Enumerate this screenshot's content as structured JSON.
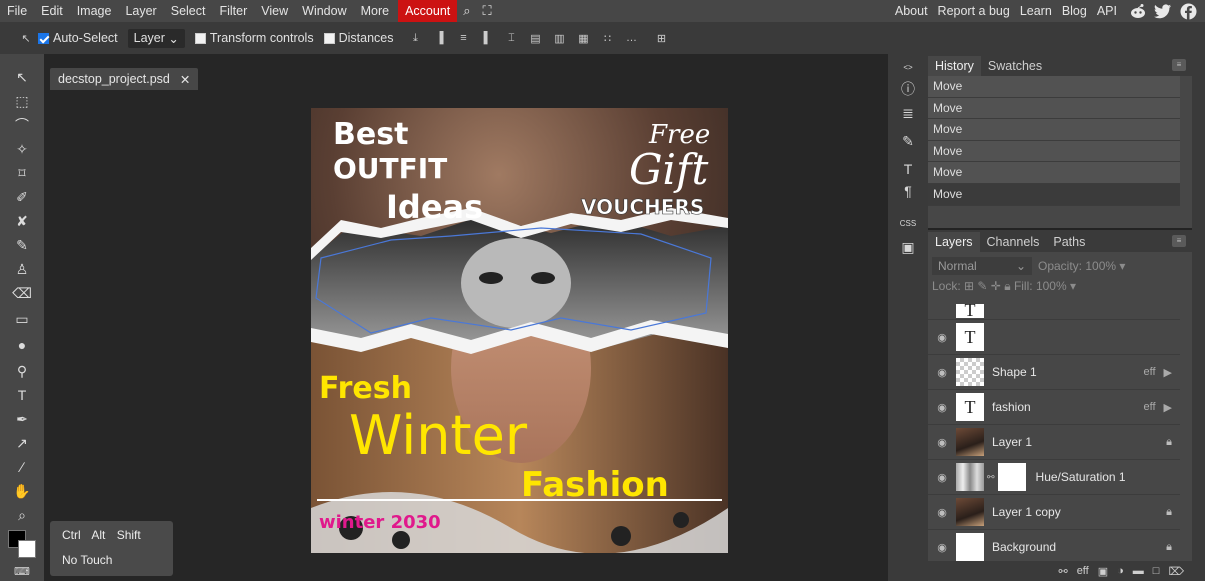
{
  "menu": {
    "items": [
      "File",
      "Edit",
      "Image",
      "Layer",
      "Select",
      "Filter",
      "View",
      "Window",
      "More"
    ],
    "account": "Account",
    "right_items": [
      "About",
      "Report a bug",
      "Learn",
      "Blog",
      "API"
    ]
  },
  "options": {
    "auto_select": "Auto-Select",
    "layer_select": "Layer",
    "transform_controls": "Transform controls",
    "distances": "Distances"
  },
  "document": {
    "tab_name": "decstop_project.psd",
    "poster": {
      "headline": [
        "Best",
        "OUTFIT",
        "Ideas"
      ],
      "free": "Free",
      "gift": "Gift",
      "vouchers": "VOUCHERS",
      "fresh": "Fresh",
      "winter": "Winter",
      "fashion": "Fashion",
      "year_line": "winter 2030"
    }
  },
  "key_help": {
    "modifiers": [
      "Ctrl",
      "Alt",
      "Shift"
    ],
    "mode": "No Touch"
  },
  "history": {
    "tabs": [
      "History",
      "Swatches"
    ],
    "items": [
      "Move",
      "Move",
      "Move",
      "Move",
      "Move",
      "Move"
    ]
  },
  "layers_panel": {
    "tabs": [
      "Layers",
      "Channels",
      "Paths"
    ],
    "blend_mode": "Normal",
    "opacity_label": "Opacity:",
    "opacity_value": "100%",
    "lock_label": "Lock:",
    "fill_label": "Fill:",
    "fill_value": "100%",
    "layers": [
      {
        "name": "",
        "thumb": "T",
        "fx": ""
      },
      {
        "name": "Shape 1",
        "thumb": "checker",
        "fx": "eff"
      },
      {
        "name": "fashion",
        "thumb": "T",
        "fx": "eff"
      },
      {
        "name": "Layer 1",
        "thumb": "photo",
        "fx": ""
      },
      {
        "name": "Hue/Saturation 1",
        "thumb": "grad",
        "fx": ""
      },
      {
        "name": "Layer 1 copy",
        "thumb": "photo",
        "fx": ""
      },
      {
        "name": "Background",
        "thumb": "white",
        "fx": ""
      }
    ]
  },
  "colors": {
    "account_bg": "#cc1212",
    "poster_yellow": "#ffe600",
    "poster_magenta": "#e0198c",
    "selection_blue": "#4a78d8"
  }
}
